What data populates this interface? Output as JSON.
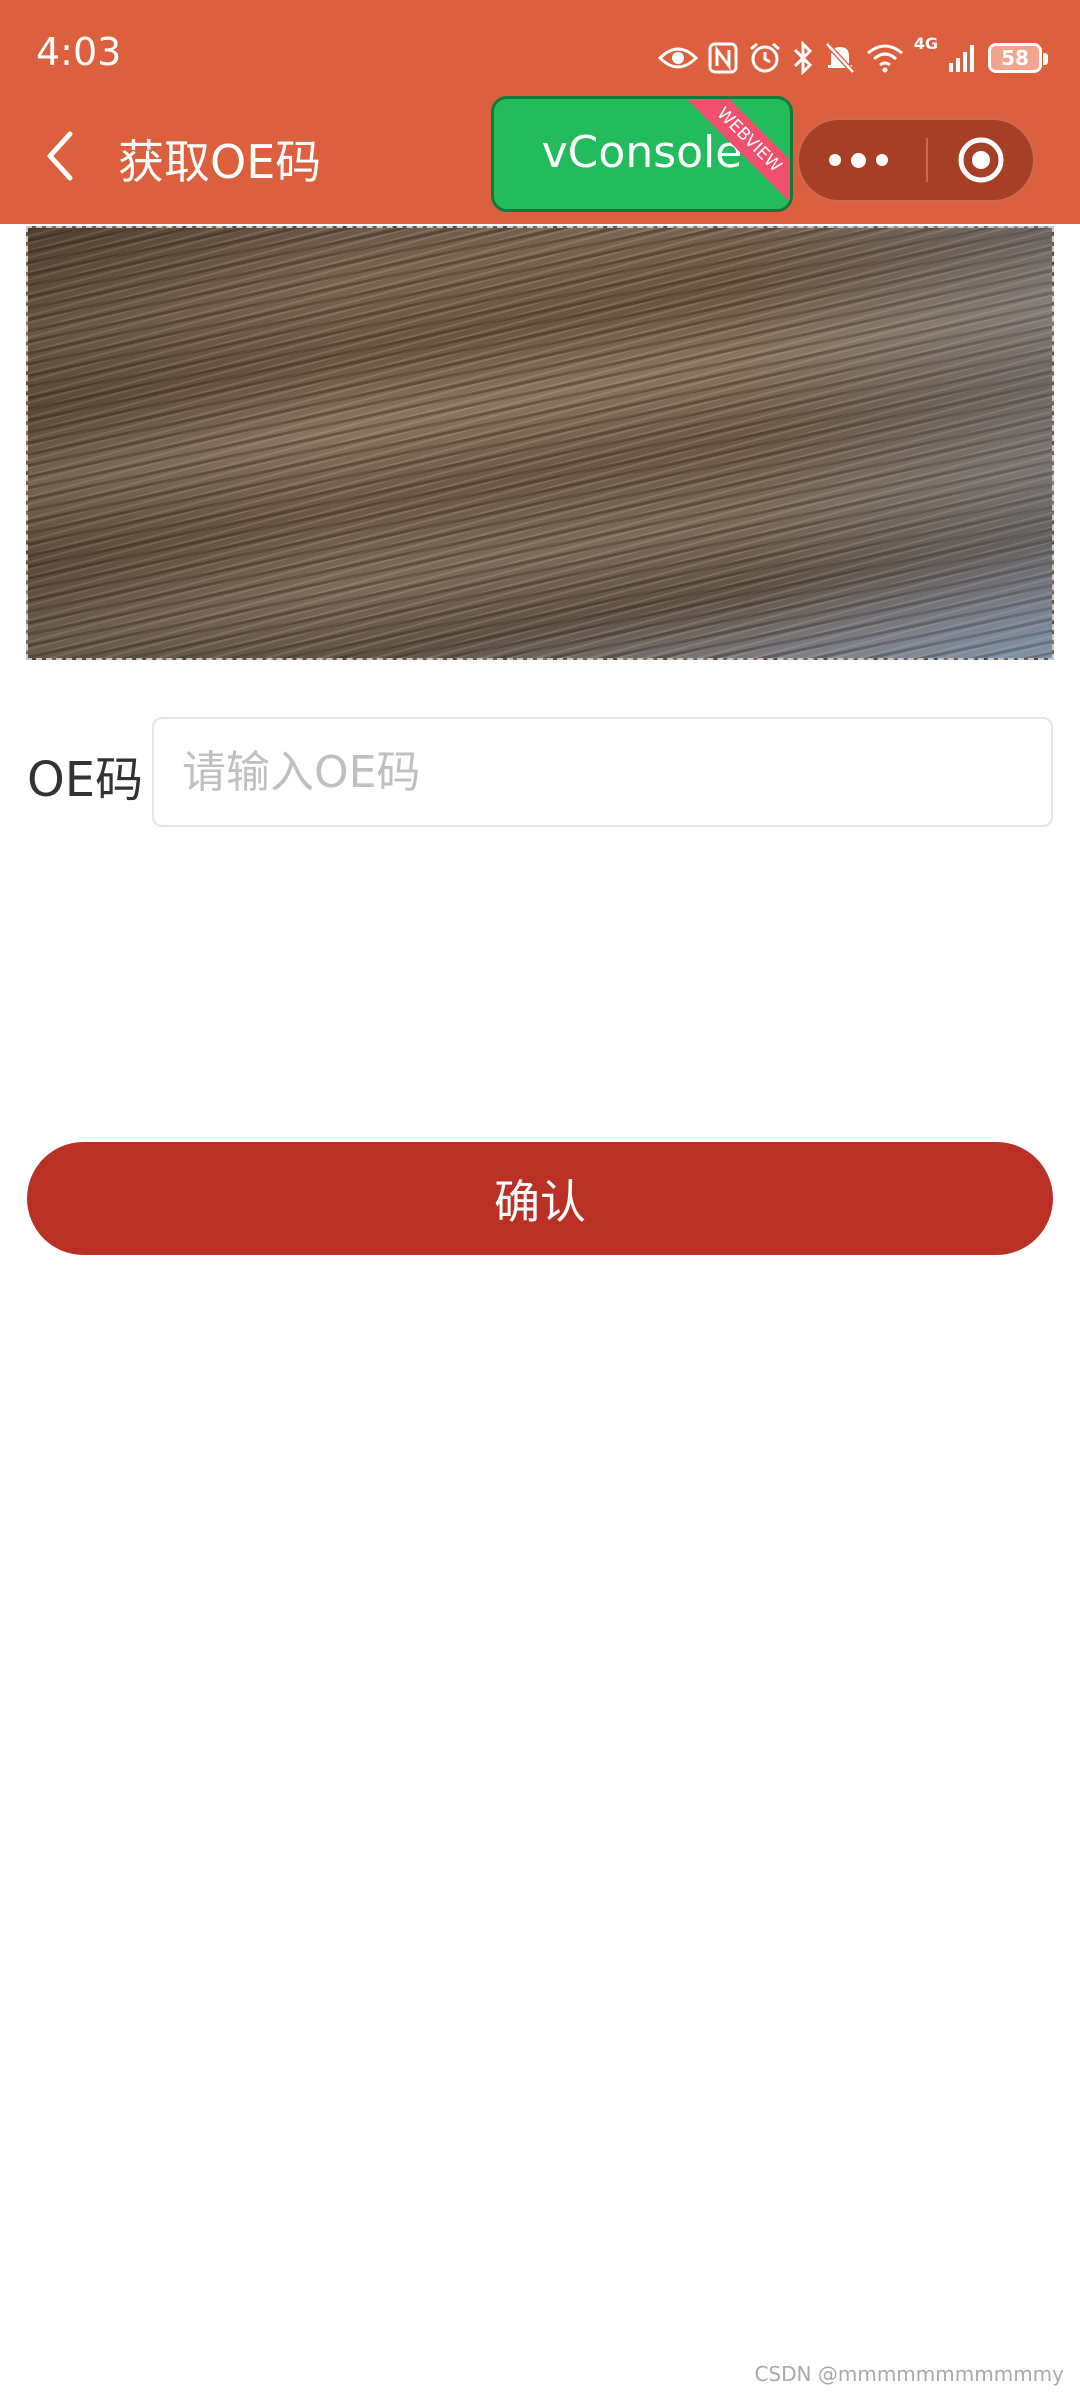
{
  "status_bar": {
    "time": "4:03",
    "network": "4G",
    "battery": "58",
    "icons": [
      "eye-icon",
      "nfc-icon",
      "alarm-icon",
      "bluetooth-icon",
      "bell-off-icon",
      "wifi-icon",
      "signal-icon",
      "battery-icon"
    ]
  },
  "nav": {
    "title": "获取OE码",
    "back_icon": "chevron-left-icon"
  },
  "vconsole": {
    "label": "vConsole",
    "ribbon": "WEBVIEW",
    "color": "#22bc5d"
  },
  "capsule": {
    "more_icon": "more-dots-icon",
    "close_icon": "target-circle-icon"
  },
  "photo": {
    "description_icon": "wood-texture-photo"
  },
  "form": {
    "oe_label": "OE码",
    "oe_placeholder": "请输入OE码",
    "oe_value": ""
  },
  "confirm": {
    "label": "确认",
    "color": "#bb3024"
  },
  "watermark": "CSDN @mmmmmmmmmmmy",
  "colors": {
    "header": "#dc5f3e",
    "capsule": "#a63f26"
  }
}
